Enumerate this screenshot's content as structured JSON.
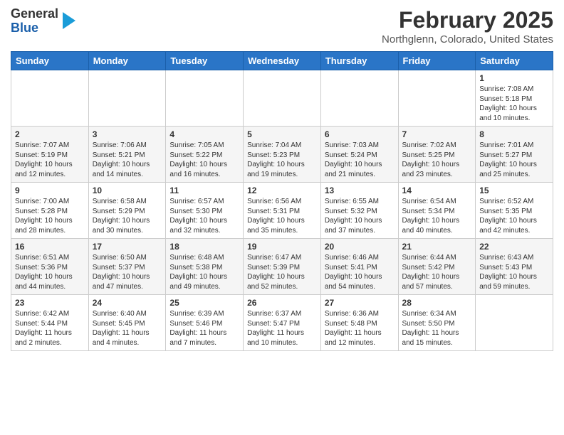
{
  "header": {
    "logo": {
      "line1": "General",
      "line2": "Blue"
    },
    "title": "February 2025",
    "location": "Northglenn, Colorado, United States"
  },
  "weekdays": [
    "Sunday",
    "Monday",
    "Tuesday",
    "Wednesday",
    "Thursday",
    "Friday",
    "Saturday"
  ],
  "weeks": [
    [
      {
        "day": "",
        "info": ""
      },
      {
        "day": "",
        "info": ""
      },
      {
        "day": "",
        "info": ""
      },
      {
        "day": "",
        "info": ""
      },
      {
        "day": "",
        "info": ""
      },
      {
        "day": "",
        "info": ""
      },
      {
        "day": "1",
        "info": "Sunrise: 7:08 AM\nSunset: 5:18 PM\nDaylight: 10 hours\nand 10 minutes."
      }
    ],
    [
      {
        "day": "2",
        "info": "Sunrise: 7:07 AM\nSunset: 5:19 PM\nDaylight: 10 hours\nand 12 minutes."
      },
      {
        "day": "3",
        "info": "Sunrise: 7:06 AM\nSunset: 5:21 PM\nDaylight: 10 hours\nand 14 minutes."
      },
      {
        "day": "4",
        "info": "Sunrise: 7:05 AM\nSunset: 5:22 PM\nDaylight: 10 hours\nand 16 minutes."
      },
      {
        "day": "5",
        "info": "Sunrise: 7:04 AM\nSunset: 5:23 PM\nDaylight: 10 hours\nand 19 minutes."
      },
      {
        "day": "6",
        "info": "Sunrise: 7:03 AM\nSunset: 5:24 PM\nDaylight: 10 hours\nand 21 minutes."
      },
      {
        "day": "7",
        "info": "Sunrise: 7:02 AM\nSunset: 5:25 PM\nDaylight: 10 hours\nand 23 minutes."
      },
      {
        "day": "8",
        "info": "Sunrise: 7:01 AM\nSunset: 5:27 PM\nDaylight: 10 hours\nand 25 minutes."
      }
    ],
    [
      {
        "day": "9",
        "info": "Sunrise: 7:00 AM\nSunset: 5:28 PM\nDaylight: 10 hours\nand 28 minutes."
      },
      {
        "day": "10",
        "info": "Sunrise: 6:58 AM\nSunset: 5:29 PM\nDaylight: 10 hours\nand 30 minutes."
      },
      {
        "day": "11",
        "info": "Sunrise: 6:57 AM\nSunset: 5:30 PM\nDaylight: 10 hours\nand 32 minutes."
      },
      {
        "day": "12",
        "info": "Sunrise: 6:56 AM\nSunset: 5:31 PM\nDaylight: 10 hours\nand 35 minutes."
      },
      {
        "day": "13",
        "info": "Sunrise: 6:55 AM\nSunset: 5:32 PM\nDaylight: 10 hours\nand 37 minutes."
      },
      {
        "day": "14",
        "info": "Sunrise: 6:54 AM\nSunset: 5:34 PM\nDaylight: 10 hours\nand 40 minutes."
      },
      {
        "day": "15",
        "info": "Sunrise: 6:52 AM\nSunset: 5:35 PM\nDaylight: 10 hours\nand 42 minutes."
      }
    ],
    [
      {
        "day": "16",
        "info": "Sunrise: 6:51 AM\nSunset: 5:36 PM\nDaylight: 10 hours\nand 44 minutes."
      },
      {
        "day": "17",
        "info": "Sunrise: 6:50 AM\nSunset: 5:37 PM\nDaylight: 10 hours\nand 47 minutes."
      },
      {
        "day": "18",
        "info": "Sunrise: 6:48 AM\nSunset: 5:38 PM\nDaylight: 10 hours\nand 49 minutes."
      },
      {
        "day": "19",
        "info": "Sunrise: 6:47 AM\nSunset: 5:39 PM\nDaylight: 10 hours\nand 52 minutes."
      },
      {
        "day": "20",
        "info": "Sunrise: 6:46 AM\nSunset: 5:41 PM\nDaylight: 10 hours\nand 54 minutes."
      },
      {
        "day": "21",
        "info": "Sunrise: 6:44 AM\nSunset: 5:42 PM\nDaylight: 10 hours\nand 57 minutes."
      },
      {
        "day": "22",
        "info": "Sunrise: 6:43 AM\nSunset: 5:43 PM\nDaylight: 10 hours\nand 59 minutes."
      }
    ],
    [
      {
        "day": "23",
        "info": "Sunrise: 6:42 AM\nSunset: 5:44 PM\nDaylight: 11 hours\nand 2 minutes."
      },
      {
        "day": "24",
        "info": "Sunrise: 6:40 AM\nSunset: 5:45 PM\nDaylight: 11 hours\nand 4 minutes."
      },
      {
        "day": "25",
        "info": "Sunrise: 6:39 AM\nSunset: 5:46 PM\nDaylight: 11 hours\nand 7 minutes."
      },
      {
        "day": "26",
        "info": "Sunrise: 6:37 AM\nSunset: 5:47 PM\nDaylight: 11 hours\nand 10 minutes."
      },
      {
        "day": "27",
        "info": "Sunrise: 6:36 AM\nSunset: 5:48 PM\nDaylight: 11 hours\nand 12 minutes."
      },
      {
        "day": "28",
        "info": "Sunrise: 6:34 AM\nSunset: 5:50 PM\nDaylight: 11 hours\nand 15 minutes."
      },
      {
        "day": "",
        "info": ""
      }
    ]
  ]
}
